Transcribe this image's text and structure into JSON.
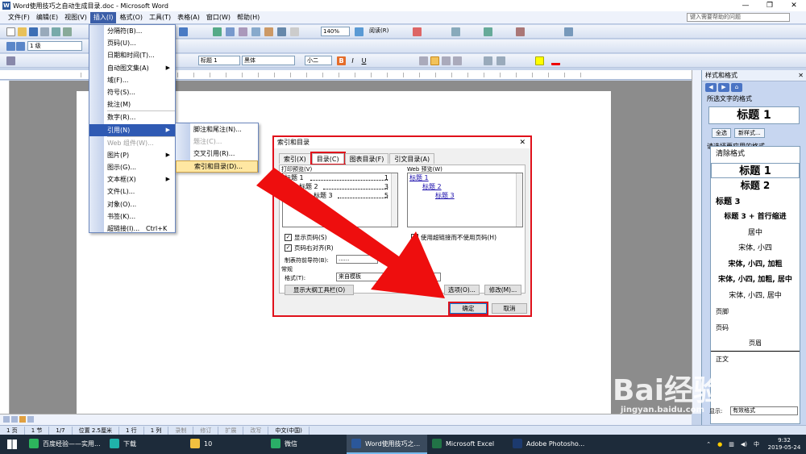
{
  "window": {
    "title": "Word使用技巧之自动生成目录.doc - Microsoft Word",
    "controls": [
      "—",
      "❐",
      "✕"
    ]
  },
  "menubar": {
    "items": [
      "文件(F)",
      "编辑(E)",
      "视图(V)",
      "插入(I)",
      "格式(O)",
      "工具(T)",
      "表格(A)",
      "窗口(W)",
      "帮助(H)"
    ],
    "active": "插入(I)",
    "help_placeholder": "键入需要帮助的问题"
  },
  "toolbar": {
    "zoom": "140%",
    "read_mode": "阅读(R)",
    "outline_level": "1 级",
    "style": "标题 1",
    "font": "黑体",
    "font_size": "小二"
  },
  "insert_menu": {
    "items": [
      {
        "label": "分隔符(B)...",
        "enabled": true
      },
      {
        "label": "页码(U)...",
        "enabled": true
      },
      {
        "label": "日期和时间(T)...",
        "enabled": true
      },
      {
        "label": "自动图文集(A)",
        "enabled": true,
        "submenu": true
      },
      {
        "label": "域(F)...",
        "enabled": true
      },
      {
        "label": "符号(S)...",
        "enabled": true
      },
      {
        "label": "批注(M)",
        "enabled": true
      },
      {
        "label": "数字(R)...",
        "enabled": true
      },
      {
        "label": "引用(N)",
        "enabled": true,
        "submenu": true,
        "selected": true
      },
      {
        "label": "Web 组件(W)...",
        "enabled": false
      },
      {
        "label": "图片(P)",
        "enabled": true,
        "submenu": true
      },
      {
        "label": "图示(G)...",
        "enabled": true
      },
      {
        "label": "文本框(X)",
        "enabled": true,
        "submenu": true
      },
      {
        "label": "文件(L)...",
        "enabled": true
      },
      {
        "label": "对象(O)...",
        "enabled": true
      },
      {
        "label": "书签(K)...",
        "enabled": true
      },
      {
        "label": "超链接(I)...",
        "enabled": true,
        "shortcut": "Ctrl+K"
      }
    ]
  },
  "reference_submenu": {
    "items": [
      {
        "label": "脚注和尾注(N)...",
        "enabled": true
      },
      {
        "label": "题注(C)...",
        "enabled": false
      },
      {
        "label": "交叉引用(R)...",
        "enabled": true
      },
      {
        "label": "索引和目录(D)...",
        "enabled": true,
        "hover": true
      }
    ]
  },
  "dialog": {
    "title": "索引和目录",
    "tabs": [
      "索引(X)",
      "目录(C)",
      "图表目录(F)",
      "引文目录(A)"
    ],
    "active_tab": "目录(C)",
    "print_preview_label": "打印预览(V)",
    "print_preview": [
      {
        "text": "标题 1",
        "page": "1"
      },
      {
        "text": "标题 2",
        "page": "3"
      },
      {
        "text": "标题 3",
        "page": "5"
      }
    ],
    "web_preview_label": "Web 预览(W)",
    "web_preview": [
      "标题 1",
      "标题 2",
      "标题 3"
    ],
    "show_page_numbers": "显示页码(S)",
    "right_align": "页码右对齐(R)",
    "use_hyperlinks": "使用超链接而不使用页码(H)",
    "tab_leader_label": "制表符前导符(B):",
    "tab_leader_value": "......",
    "general_label": "常规",
    "format_label": "格式(T):",
    "format_value": "来自模板",
    "outline_toolbar_btn": "显示大纲工具栏(O)",
    "options_btn": "选项(O)...",
    "modify_btn": "修改(M)...",
    "ok_btn": "确定",
    "cancel_btn": "取消",
    "close": "✕"
  },
  "taskpane": {
    "title": "样式和格式",
    "current_label": "所选文字的格式",
    "current_style": "标题 1",
    "select_all": "全选",
    "new_style": "新样式...",
    "apply_label": "请选择要应用的格式",
    "styles": [
      "清除格式",
      "标题 1",
      "标题 2",
      "标题 3",
      "标题 3 + 首行缩进",
      "居中",
      "宋体, 小四",
      "宋体, 小四, 加粗",
      "宋体, 小四, 加粗, 居中",
      "宋体, 小四, 居中",
      "页脚",
      "页码",
      "页眉",
      "正文"
    ],
    "show_label": "显示:",
    "show_value": "有效格式"
  },
  "statusbar": {
    "page": "1 页",
    "section": "1 节",
    "page_of": "1/7",
    "position": "位置 2.5厘米",
    "line": "1 行",
    "column": "1 列",
    "modes": [
      "录制",
      "修订",
      "扩展",
      "改写"
    ],
    "language": "中文(中国)"
  },
  "taskbar": {
    "apps": [
      {
        "label": "百度经验——实用...",
        "color": "#2db55d"
      },
      {
        "label": "下载",
        "color": "#20b2aa"
      },
      {
        "label": "10",
        "color": "#f0c040"
      },
      {
        "label": "微信",
        "color": "#2aae67"
      },
      {
        "label": "Word使用技巧之...",
        "color": "#2b579a",
        "active": true
      },
      {
        "label": "Microsoft Excel",
        "color": "#217346"
      },
      {
        "label": "Adobe Photosho...",
        "color": "#1c3a6e"
      }
    ],
    "ime": "中",
    "time": "9:32",
    "date": "2019-05-24"
  },
  "watermark": {
    "text": "Bai经验",
    "sub": "jingyan.baidu.com"
  },
  "colors": {
    "highlight_red": "#e0111b",
    "menu_select": "#2f5ab3",
    "link": "#1a0dab"
  }
}
